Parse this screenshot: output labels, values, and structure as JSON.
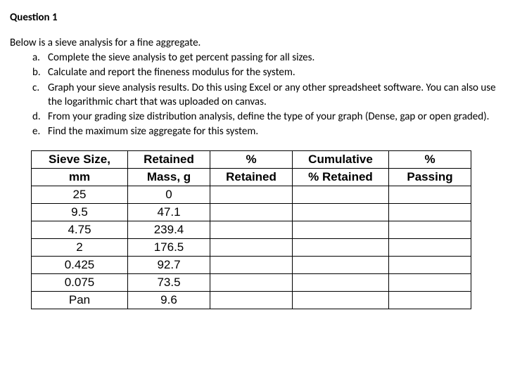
{
  "title": "Question 1",
  "intro": "Below is a sieve analysis for a fine aggregate.",
  "items": {
    "a": {
      "marker": "a.",
      "text": "Complete the sieve analysis to get percent passing for all sizes."
    },
    "b": {
      "marker": "b.",
      "text": "Calculate and report the fineness modulus for the system."
    },
    "c": {
      "marker": "c.",
      "text": "Graph your sieve analysis results. Do this using Excel or any other spreadsheet software. You can also use the logarithmic chart that was uploaded on canvas."
    },
    "d": {
      "marker": "d.",
      "text": "From your grading size distribution analysis, define the type of your graph (Dense, gap or open graded)."
    },
    "e": {
      "marker": "e.",
      "text": "Find the maximum size aggregate for this system."
    }
  },
  "headers": {
    "size1": "Sieve Size,",
    "size2": "mm",
    "mass1": "Retained",
    "mass2": "Mass, g",
    "pct1": "%",
    "pct2": "Retained",
    "cum1": "Cumulative",
    "cum2": "% Retained",
    "pass1": "%",
    "pass2": "Passing"
  },
  "rows": [
    {
      "size": "25",
      "mass": "0",
      "pret": "",
      "cum": "",
      "pass": ""
    },
    {
      "size": "9.5",
      "mass": "47.1",
      "pret": "",
      "cum": "",
      "pass": ""
    },
    {
      "size": "4.75",
      "mass": "239.4",
      "pret": "",
      "cum": "",
      "pass": ""
    },
    {
      "size": "2",
      "mass": "176.5",
      "pret": "",
      "cum": "",
      "pass": ""
    },
    {
      "size": "0.425",
      "mass": "92.7",
      "pret": "",
      "cum": "",
      "pass": ""
    },
    {
      "size": "0.075",
      "mass": "73.5",
      "pret": "",
      "cum": "",
      "pass": ""
    },
    {
      "size": "Pan",
      "mass": "9.6",
      "pret": "",
      "cum": "",
      "pass": ""
    }
  ],
  "chart_data": {
    "type": "table",
    "title": "Sieve analysis for a fine aggregate",
    "columns": [
      "Sieve Size, mm",
      "Retained Mass, g",
      "% Retained",
      "Cumulative % Retained",
      "% Passing"
    ],
    "rows": [
      [
        "25",
        0,
        null,
        null,
        null
      ],
      [
        "9.5",
        47.1,
        null,
        null,
        null
      ],
      [
        "4.75",
        239.4,
        null,
        null,
        null
      ],
      [
        "2",
        176.5,
        null,
        null,
        null
      ],
      [
        "0.425",
        92.7,
        null,
        null,
        null
      ],
      [
        "0.075",
        73.5,
        null,
        null,
        null
      ],
      [
        "Pan",
        9.6,
        null,
        null,
        null
      ]
    ]
  }
}
